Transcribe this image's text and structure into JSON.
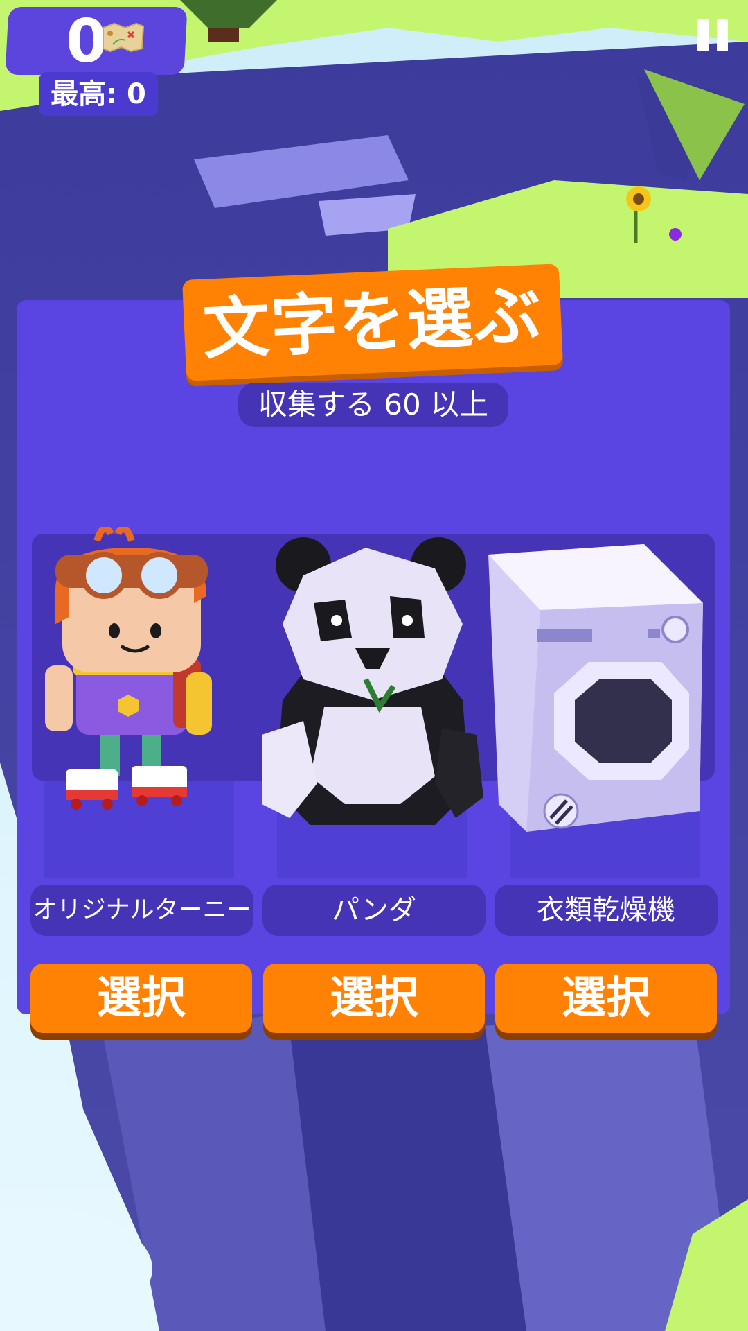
{
  "hud": {
    "score": "0",
    "best_label": "最高: 0",
    "map_icon": "treasure-map-icon",
    "pause_icon": "pause-icon"
  },
  "panel": {
    "title": "文字を選ぶ",
    "subtitle": "収集する 60 以上",
    "characters": [
      {
        "name": "オリジナルターニー",
        "button": "選択",
        "icon": "explorer-girl"
      },
      {
        "name": "パンダ",
        "button": "選択",
        "icon": "panda"
      },
      {
        "name": "衣類乾燥機",
        "button": "選択",
        "icon": "clothes-dryer"
      }
    ]
  },
  "colors": {
    "panel": "#5a45e3",
    "accent_orange": "#ff8205",
    "pill": "#4634b7",
    "grass": "#c4f56f",
    "cliff": "#3f3f9e"
  }
}
